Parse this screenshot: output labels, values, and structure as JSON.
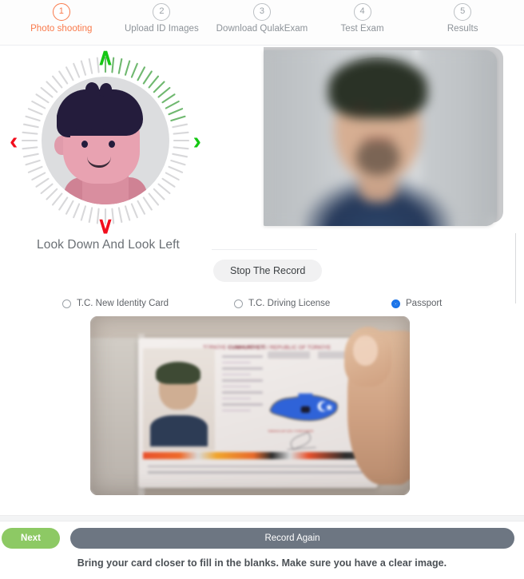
{
  "stepper": {
    "steps": [
      {
        "number": "1",
        "label": "Photo shooting",
        "active": true
      },
      {
        "number": "2",
        "label": "Upload ID Images",
        "active": false
      },
      {
        "number": "3",
        "label": "Download QulakExam",
        "active": false
      },
      {
        "number": "4",
        "label": "Test Exam",
        "active": false
      },
      {
        "number": "5",
        "label": "Results",
        "active": false
      }
    ],
    "active_color": "#f9794a",
    "inactive_color": "#8d9399"
  },
  "face_guide": {
    "instruction": "Look Down And Look Left",
    "arrows": {
      "up": {
        "icon": "chevron-up-icon",
        "color": "#13c712",
        "state": "done"
      },
      "right": {
        "icon": "chevron-right-icon",
        "color": "#13c712",
        "state": "done"
      },
      "down": {
        "icon": "chevron-down-icon",
        "color": "#f20d1c",
        "state": "pending"
      },
      "left": {
        "icon": "chevron-left-icon",
        "color": "#f20d1c",
        "state": "pending"
      }
    },
    "progress_ring": {
      "total_ticks": 64,
      "completed_ticks": 14,
      "start_tick": 0,
      "done_color": "#6fb86f",
      "pending_color": "#d8d8da"
    },
    "avatar": {
      "icon": "avatar-face-icon",
      "skin_color": "#e8a2b1",
      "hair_color": "#241c3c",
      "background_color": "#dcdddf"
    }
  },
  "video": {
    "name": "webcam-preview",
    "blurred": true,
    "description": "Blurred live webcam feed of a person facing the camera"
  },
  "record": {
    "stop_label": "Stop The Record"
  },
  "document_type": {
    "options": [
      {
        "label": "T.C. New Identity Card",
        "value": "new_identity_card",
        "selected": false
      },
      {
        "label": "T.C. Driving License",
        "value": "driving_license",
        "selected": false
      },
      {
        "label": "Passport",
        "value": "passport",
        "selected": true
      }
    ],
    "selected_color": "#1a73e8"
  },
  "id_preview": {
    "name": "id-document-preview",
    "blurred": true,
    "header_plain": "TÜRKİYE ",
    "header_bold": "CUMHURİYETİ",
    "header_rest": " / REPUBLIC OF TÜRKİYE",
    "map_label": "YABANCILAR İÇİN / FOREIGNERS",
    "description": "Photo of a Turkish passport data page held in a hand"
  },
  "footer": {
    "next_label": "Next",
    "next_color": "#8dc964",
    "record_again_label": "Record Again",
    "record_again_color": "#6d7682",
    "hint": "Bring your card closer to fill in the blanks. Make sure you have a clear image."
  }
}
